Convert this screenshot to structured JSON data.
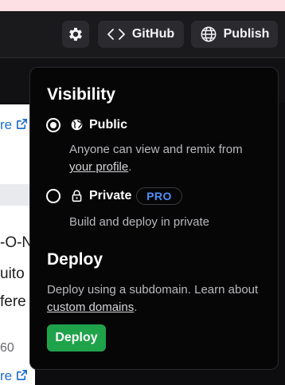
{
  "header": {
    "settings_icon": "gear-icon",
    "github_label": "GitHub",
    "github_icon": "code-brackets-icon",
    "publish_label": "Publish",
    "publish_icon": "globe-icon"
  },
  "background": {
    "more_link_1": "re",
    "more_link_2": "re",
    "line_1": "-O-N",
    "line_2": "uito",
    "line_3": "fere",
    "number": "60"
  },
  "publish_panel": {
    "visibility_title": "Visibility",
    "options": [
      {
        "label": "Public",
        "icon": "globe-icon",
        "selected": true,
        "description_prefix": "Anyone can view and remix from",
        "description_link": "your profile",
        "description_suffix": "."
      },
      {
        "label": "Private",
        "icon": "lock-icon",
        "selected": false,
        "badge": "PRO",
        "description": "Build and deploy in private"
      }
    ],
    "deploy_title": "Deploy",
    "deploy_description_prefix": "Deploy using a subdomain. Learn about",
    "deploy_description_link": "custom domains",
    "deploy_description_suffix": ".",
    "deploy_button": "Deploy"
  },
  "colors": {
    "accent_green": "#1fa34a",
    "badge_blue": "#4d8ef7",
    "panel_bg": "#060607"
  }
}
